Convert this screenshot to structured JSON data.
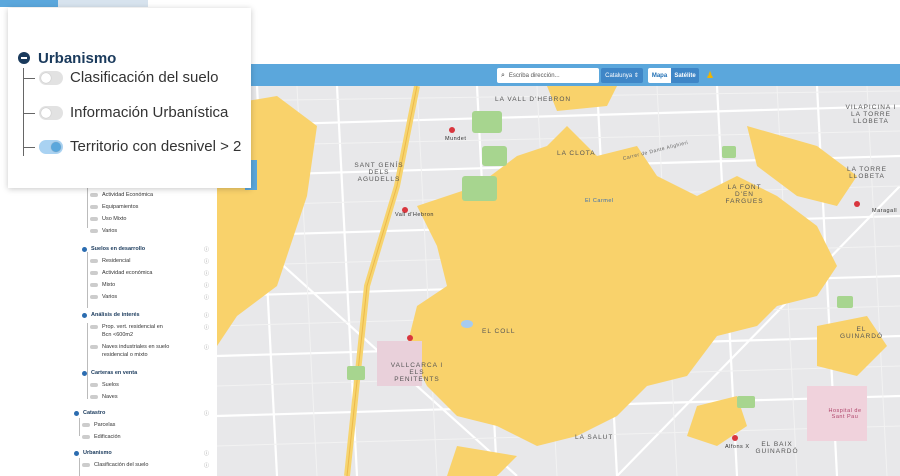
{
  "topbar": {
    "search_placeholder": "Escriba dirección...",
    "region": "Catalunya",
    "map_btn": "Mapa",
    "sat_btn": "Satélite"
  },
  "card": {
    "title": "Urbanismo",
    "items": [
      {
        "label": "Clasificación del suelo",
        "on": false
      },
      {
        "label": "Información Urbanística",
        "on": false
      },
      {
        "label": "Territorio con desnivel > 2",
        "on": true
      }
    ]
  },
  "sidebar": {
    "rows": [
      {
        "label": "Actividad Económica"
      },
      {
        "label": "Equipamientos"
      },
      {
        "label": "Uso Mixto"
      },
      {
        "label": "Varios"
      },
      {
        "group": "Suelos en desarrollo"
      },
      {
        "label": "Residencial"
      },
      {
        "label": "Actividad económica"
      },
      {
        "label": "Mixto"
      },
      {
        "label": "Varios"
      },
      {
        "group": "Análisis de interés"
      },
      {
        "label": "Prop. vert. residencial en"
      },
      {
        "label": "Bcn <600m2"
      },
      {
        "label": "Naves industriales en suelo"
      },
      {
        "label": "residencial o mixto"
      },
      {
        "group": "Carteras en venta"
      },
      {
        "label": "Suelos"
      },
      {
        "label": "Naves"
      },
      {
        "group": "Catastro"
      },
      {
        "label": "Parcelas"
      },
      {
        "label": "Edificación"
      },
      {
        "group": "Urbanismo"
      },
      {
        "label": "Clasificación del suelo"
      }
    ]
  },
  "map": {
    "labels": [
      "LA VALL D'HEBRON",
      "SANT GENÍS DELS AGUDELLS",
      "LA CLOTA",
      "Carrer de Dante Alighieri",
      "LA FONT D'EN FARGUES",
      "VILAPICINA I LA TORRE LLOBETA",
      "LA TORRE LLOBETA",
      "EL COLL",
      "EL GUINARDÓ",
      "VALLCARCA I ELS PENITENTS",
      "LA SALUT",
      "EL BAIX GUINARDÓ",
      "Hospital de Sant Pau",
      "El Carmel",
      "Vall d'Hebron",
      "Mundet",
      "Maragall",
      "Alfons X"
    ]
  }
}
